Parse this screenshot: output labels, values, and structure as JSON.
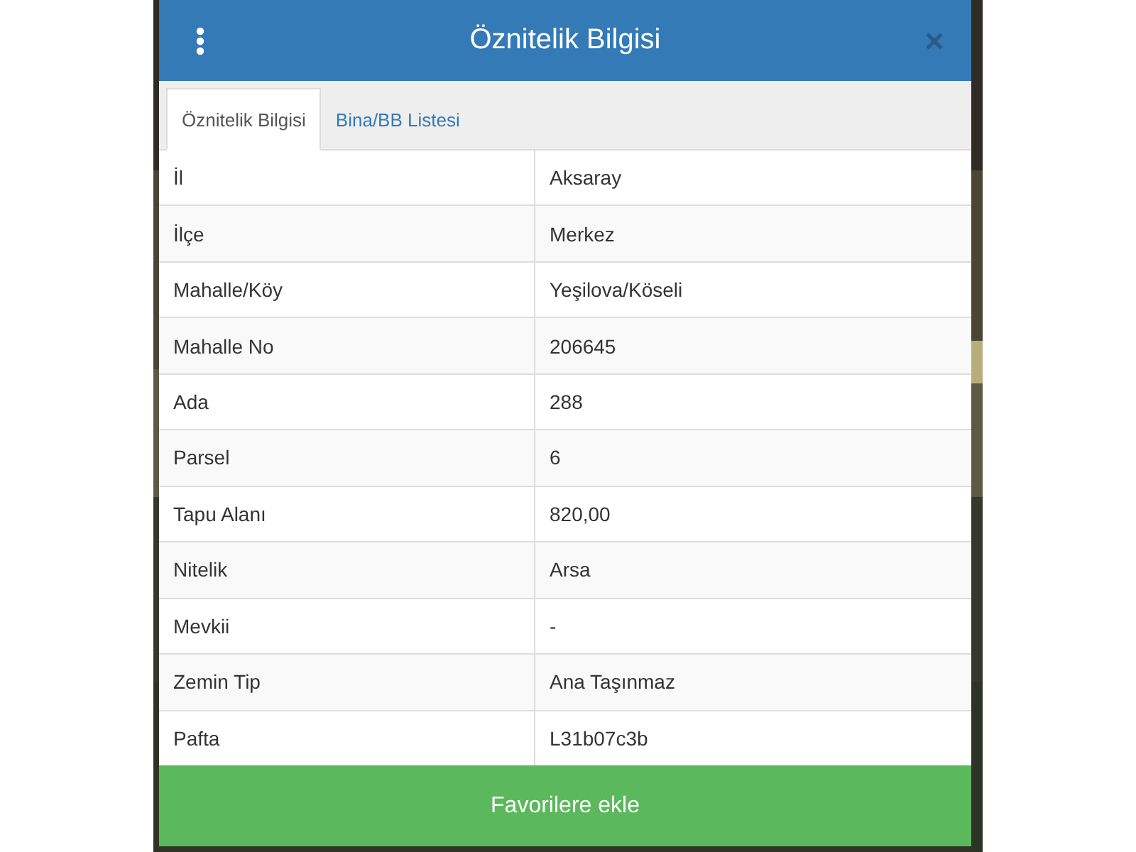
{
  "dialog": {
    "title": "Öznitelik Bilgisi"
  },
  "tabs": [
    {
      "label": "Öznitelik Bilgisi",
      "selected": true
    },
    {
      "label": "Bina/BB Listesi",
      "selected": false
    }
  ],
  "rows": [
    {
      "label": "İl",
      "value": "Aksaray"
    },
    {
      "label": "İlçe",
      "value": "Merkez"
    },
    {
      "label": "Mahalle/Köy",
      "value": "Yeşilova/Köseli"
    },
    {
      "label": "Mahalle No",
      "value": "206645"
    },
    {
      "label": "Ada",
      "value": "288"
    },
    {
      "label": "Parsel",
      "value": "6"
    },
    {
      "label": "Tapu Alanı",
      "value": "820,00"
    },
    {
      "label": "Nitelik",
      "value": "Arsa"
    },
    {
      "label": "Mevkii",
      "value": "-"
    },
    {
      "label": "Zemin Tip",
      "value": "Ana Taşınmaz"
    },
    {
      "label": "Pafta",
      "value": "L31b07c3b"
    }
  ],
  "button": {
    "label": "Favorilere ekle"
  }
}
